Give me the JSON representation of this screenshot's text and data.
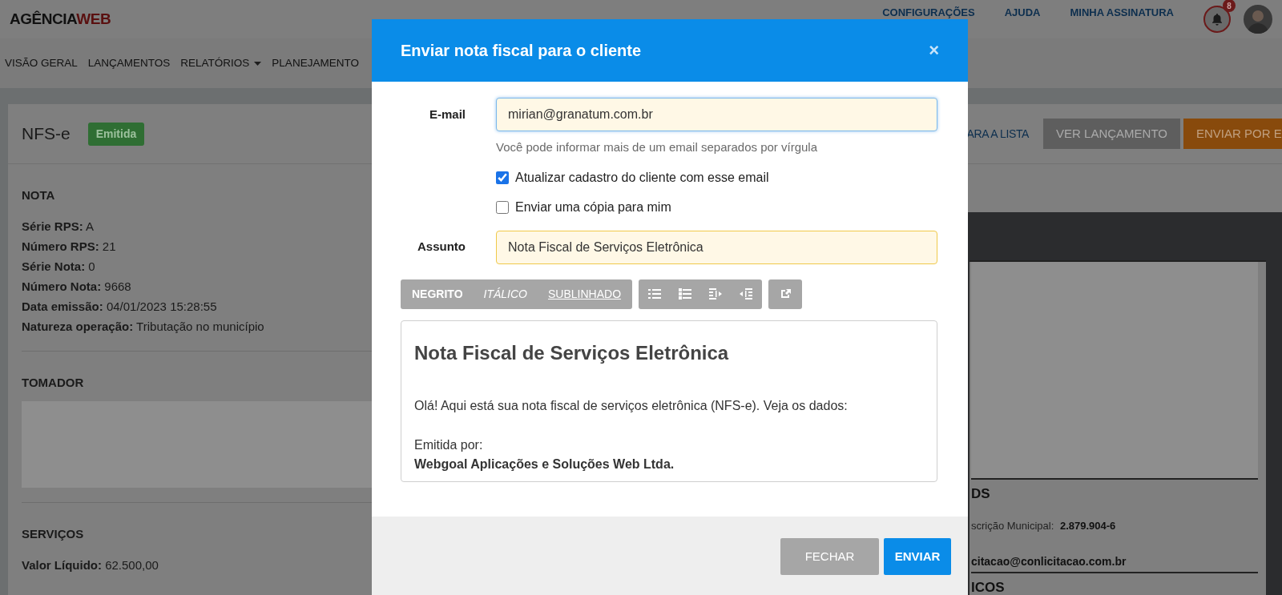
{
  "header": {
    "logo": {
      "primary": "AGÊNCIA",
      "accent": "WEB"
    },
    "links": [
      "CONFIGURAÇÕES",
      "AJUDA",
      "MINHA ASSINATURA"
    ],
    "notifications": {
      "count": "8"
    }
  },
  "nav": [
    {
      "label": "VISÃO GERAL",
      "dropdown": false
    },
    {
      "label": "LANÇAMENTOS",
      "dropdown": false
    },
    {
      "label": "RELATÓRIOS",
      "dropdown": true
    },
    {
      "label": "PLANEJAMENTO",
      "dropdown": false
    }
  ],
  "page": {
    "title": "NFS-e",
    "status": "Emitida",
    "actions": [
      {
        "label": "ARA A LISTA",
        "kind": "link"
      },
      {
        "label": "VER LANÇAMENTO",
        "kind": "secondary"
      },
      {
        "label": "ENVIAR POR E",
        "kind": "warning"
      }
    ],
    "sections": [
      {
        "heading": "NOTA",
        "kind": "fields",
        "fields": [
          "**Série RPS:** A",
          "**Número RPS:** 21",
          "**Série Nota:** 0",
          "**Número Nota:** 9668",
          "**Data emissão:** 04/01/2023 15:28:55",
          "**Natureza operação:** Tributação no município"
        ]
      },
      {
        "heading": "TOMADOR",
        "kind": "blank"
      },
      {
        "heading": "SERVIÇOS",
        "kind": "fields",
        "fields": [
          "**Valor Líquido:** 62.500,00"
        ]
      }
    ]
  },
  "document_preview": {
    "lines": [
      {
        "kind": "heading",
        "text": "DS"
      },
      {
        "kind": "pair",
        "label": "scrição Municipal:",
        "value": "2.879.904-6"
      },
      {
        "kind": "text",
        "text": "citacao@conlicitacao.com.br"
      },
      {
        "kind": "heading",
        "text": "ICOS"
      }
    ]
  },
  "dialog": {
    "title": "Enviar nota fiscal para o cliente",
    "close": "×",
    "email": {
      "label": "E-mail",
      "value": "mirian@granatum.com.br",
      "focused": true,
      "hint": "Você pode informar mais de um email separados por vírgula"
    },
    "options": [
      {
        "label": "Atualizar cadastro do cliente com esse email",
        "checked": true
      },
      {
        "label": "Enviar uma cópia para mim",
        "checked": false
      }
    ],
    "subject": {
      "label": "Assunto",
      "value": "Nota Fiscal de Serviços Eletrônica",
      "focused": false
    },
    "toolbar": [
      {
        "label": "NEGRITO",
        "kind": "bold"
      },
      {
        "label": "ITÁLICO",
        "kind": "italic"
      },
      {
        "label": "SUBLINHADO",
        "kind": "underline"
      }
    ],
    "editor": {
      "heading": "Nota Fiscal de Serviços Eletrônica",
      "paragraphs": [
        [
          {
            "text": "Olá! Aqui está sua nota fiscal de serviços eletrônica (NFS-e). Veja os dados:",
            "bold": false
          }
        ],
        [
          {
            "text": "Emitida por:",
            "bold": false
          },
          {
            "text": "Webgoal Aplicações e Soluções Web Ltda.",
            "bold": true
          }
        ]
      ]
    },
    "buttons": [
      {
        "label": "FECHAR",
        "kind": "secondary"
      },
      {
        "label": "ENVIAR",
        "kind": "primary"
      }
    ]
  }
}
